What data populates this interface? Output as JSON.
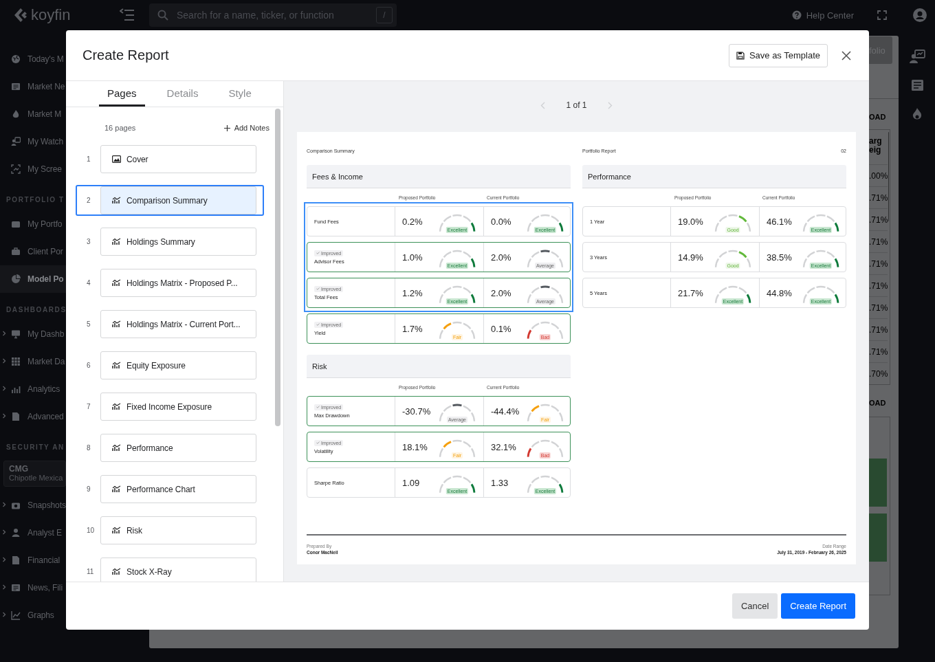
{
  "topbar": {
    "logo": "koyfin",
    "search": {
      "placeholder": "Search for a name, ticker, or function",
      "shortcut": "/"
    },
    "help": "Help Center"
  },
  "sidebar": {
    "sections": [
      {
        "items": [
          {
            "label": "Today's M",
            "selected": false
          },
          {
            "label": "Market Ne",
            "selected": false
          },
          {
            "label": "Market M",
            "selected": false
          },
          {
            "label": "My Watch",
            "selected": false
          },
          {
            "label": "My Scree",
            "selected": false
          }
        ]
      },
      {
        "title": "PORTFOLIO T",
        "items": [
          {
            "label": "My Portfo",
            "selected": false
          },
          {
            "label": "Client Por",
            "selected": false
          },
          {
            "label": "Model Po",
            "selected": true
          }
        ]
      },
      {
        "title": "DASHBOARDS",
        "items": [
          {
            "label": "My Dashb",
            "selected": false,
            "expanded": false
          },
          {
            "label": "Market Da",
            "selected": false,
            "expanded": false
          },
          {
            "label": "Analytics",
            "selected": false,
            "expanded": false
          },
          {
            "label": "Advanced",
            "selected": false,
            "expanded": false
          }
        ]
      },
      {
        "title": "SECURITY AN",
        "ticker": {
          "symbol": "CMG",
          "name": "Chipotle Mexica"
        },
        "items": [
          {
            "label": "Snapshots",
            "selected": false,
            "expanded": false
          },
          {
            "label": "Analyst E",
            "selected": false,
            "expanded": false
          },
          {
            "label": "Financial",
            "selected": false,
            "expanded": false
          },
          {
            "label": "News, Fili",
            "selected": false,
            "expanded": false
          },
          {
            "label": "Graphs",
            "selected": false,
            "expanded": false
          }
        ]
      }
    ]
  },
  "background_panel": {
    "button": "folio",
    "sections": [
      {
        "title": "OAD",
        "header": [
          "arg",
          "eig"
        ],
        "values": [
          ".00%",
          ".71%",
          ".71%",
          ".71%",
          ".71%",
          ".71%",
          ".71%",
          ".71%",
          ".71%",
          ".70%"
        ]
      },
      {
        "title": "OAD"
      }
    ]
  },
  "modal": {
    "title": "Create Report",
    "save_template": "Save as Template",
    "tabs": [
      {
        "label": "Pages",
        "selected": true
      },
      {
        "label": "Details",
        "selected": false
      },
      {
        "label": "Style",
        "selected": false
      }
    ],
    "page_count": "16 pages",
    "add_notes": "Add Notes",
    "pages": [
      {
        "number": "1",
        "title": "Cover",
        "kind": "cover",
        "selected": false
      },
      {
        "number": "2",
        "title": "Comparison Summary",
        "kind": "chart",
        "selected": true
      },
      {
        "number": "3",
        "title": "Holdings Summary",
        "kind": "chart",
        "selected": false
      },
      {
        "number": "4",
        "title": "Holdings Matrix - Proposed P...",
        "kind": "chart",
        "selected": false
      },
      {
        "number": "5",
        "title": "Holdings Matrix - Current Port...",
        "kind": "chart",
        "selected": false
      },
      {
        "number": "6",
        "title": "Equity Exposure",
        "kind": "chart",
        "selected": false
      },
      {
        "number": "7",
        "title": "Fixed Income Exposure",
        "kind": "chart",
        "selected": false
      },
      {
        "number": "8",
        "title": "Performance",
        "kind": "chart",
        "selected": false
      },
      {
        "number": "9",
        "title": "Performance Chart",
        "kind": "chart",
        "selected": false
      },
      {
        "number": "10",
        "title": "Risk",
        "kind": "chart",
        "selected": false
      },
      {
        "number": "11",
        "title": "Stock X-Ray",
        "kind": "chart",
        "selected": false
      }
    ],
    "pager": "1 of 1",
    "report": {
      "left_title": "Comparison Summary",
      "right_title": "Portfolio Report",
      "page_number": "02",
      "columns": [
        {
          "sections": [
            {
              "title": "Fees & Income",
              "headers": [
                "Proposed Portfolio",
                "Current Portfolio"
              ],
              "rows": [
                {
                  "label": "Fund Fees",
                  "improved": false,
                  "selected": true,
                  "cells": [
                    {
                      "value": "0.2%",
                      "rating": "Excellent",
                      "kind": "excellent"
                    },
                    {
                      "value": "0.0%",
                      "rating": "Excellent",
                      "kind": "excellent"
                    }
                  ]
                },
                {
                  "label": "Advisor Fees",
                  "improved": true,
                  "tag": "Improved",
                  "selected": true,
                  "cells": [
                    {
                      "value": "1.0%",
                      "rating": "Excellent",
                      "kind": "excellent"
                    },
                    {
                      "value": "2.0%",
                      "rating": "Average",
                      "kind": "average"
                    }
                  ]
                },
                {
                  "label": "Total Fees",
                  "improved": true,
                  "tag": "Improved",
                  "selected": true,
                  "cells": [
                    {
                      "value": "1.2%",
                      "rating": "Excellent",
                      "kind": "excellent"
                    },
                    {
                      "value": "2.0%",
                      "rating": "Average",
                      "kind": "average"
                    }
                  ]
                },
                {
                  "label": "Yield",
                  "improved": true,
                  "tag": "Improved",
                  "selected": false,
                  "cells": [
                    {
                      "value": "1.7%",
                      "rating": "Fair",
                      "kind": "fair"
                    },
                    {
                      "value": "0.1%",
                      "rating": "Bad",
                      "kind": "bad"
                    }
                  ]
                }
              ]
            },
            {
              "title": "Risk",
              "headers": [
                "Proposed Portfolio",
                "Current Portfolio"
              ],
              "rows": [
                {
                  "label": "Max Drawdown",
                  "improved": true,
                  "tag": "Improved",
                  "selected": false,
                  "cells": [
                    {
                      "value": "-30.7%",
                      "rating": "Average",
                      "kind": "average"
                    },
                    {
                      "value": "-44.4%",
                      "rating": "Fair",
                      "kind": "fair"
                    }
                  ]
                },
                {
                  "label": "Volatility",
                  "improved": true,
                  "tag": "Improved",
                  "selected": false,
                  "cells": [
                    {
                      "value": "18.1%",
                      "rating": "Fair",
                      "kind": "fair"
                    },
                    {
                      "value": "32.1%",
                      "rating": "Bad",
                      "kind": "bad"
                    }
                  ]
                },
                {
                  "label": "Sharpe Ratio",
                  "improved": false,
                  "selected": false,
                  "cells": [
                    {
                      "value": "1.09",
                      "rating": "Excellent",
                      "kind": "excellent"
                    },
                    {
                      "value": "1.33",
                      "rating": "Excellent",
                      "kind": "excellent"
                    }
                  ]
                }
              ]
            }
          ]
        },
        {
          "sections": [
            {
              "title": "Performance",
              "headers": [
                "Proposed Portfolio",
                "Current Portfolio"
              ],
              "rows": [
                {
                  "label": "1 Year",
                  "improved": false,
                  "selected": false,
                  "cells": [
                    {
                      "value": "19.0%",
                      "rating": "Good",
                      "kind": "good"
                    },
                    {
                      "value": "46.1%",
                      "rating": "Excellent",
                      "kind": "excellent"
                    }
                  ]
                },
                {
                  "label": "3 Years",
                  "improved": false,
                  "selected": false,
                  "cells": [
                    {
                      "value": "14.9%",
                      "rating": "Good",
                      "kind": "good"
                    },
                    {
                      "value": "38.5%",
                      "rating": "Excellent",
                      "kind": "excellent"
                    }
                  ]
                },
                {
                  "label": "5 Years",
                  "improved": false,
                  "selected": false,
                  "cells": [
                    {
                      "value": "21.7%",
                      "rating": "Excellent",
                      "kind": "excellent"
                    },
                    {
                      "value": "44.8%",
                      "rating": "Excellent",
                      "kind": "excellent"
                    }
                  ]
                }
              ]
            }
          ]
        }
      ],
      "prepared_label": "Prepared By",
      "prepared_by": "Conor MacNeil",
      "date_label": "Date Range",
      "date_range": "July 31, 2019 - February 26, 2025"
    },
    "cancel": "Cancel",
    "create": "Create Report"
  }
}
